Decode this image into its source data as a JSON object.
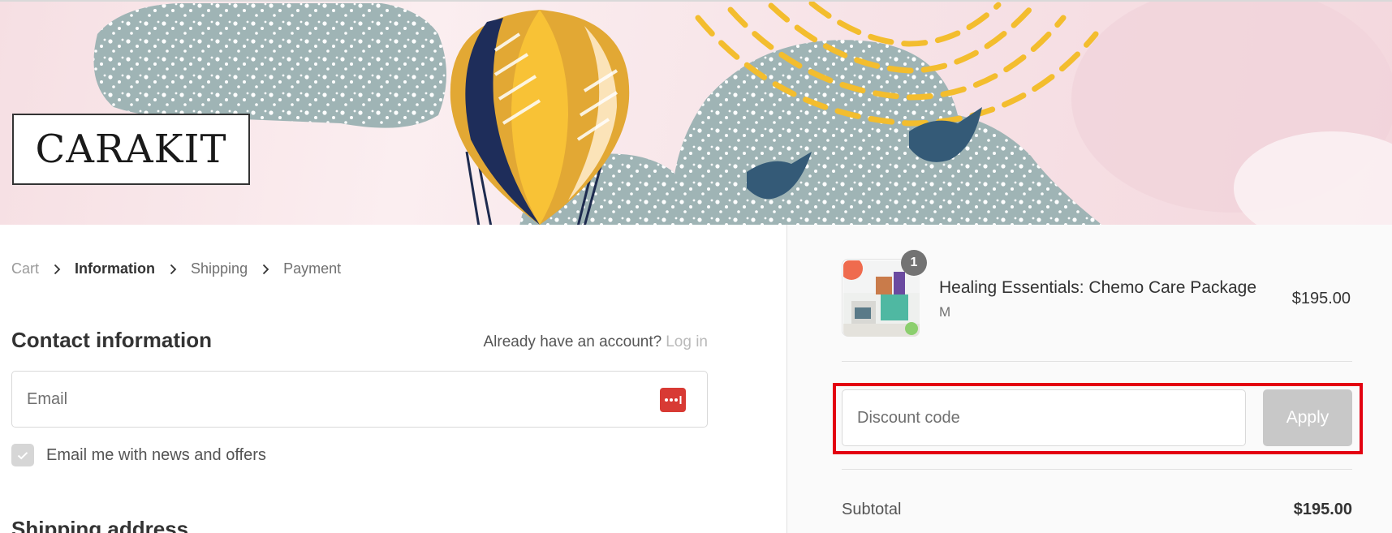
{
  "header": {
    "logo_text": "CARAKIT"
  },
  "breadcrumb": {
    "items": [
      {
        "label": "Cart",
        "state": "link"
      },
      {
        "label": "Information",
        "state": "current"
      },
      {
        "label": "Shipping",
        "state": "upcoming"
      },
      {
        "label": "Payment",
        "state": "upcoming"
      }
    ]
  },
  "contact": {
    "title": "Contact information",
    "account_prompt": "Already have an account?",
    "login_label": "Log in",
    "email_placeholder": "Email",
    "email_value": "",
    "newsletter_label": "Email me with news and offers",
    "newsletter_checked": true
  },
  "shipping": {
    "title": "Shipping address"
  },
  "order_summary": {
    "items": [
      {
        "name": "Healing Essentials: Chemo Care Package",
        "variant": "M",
        "quantity": "1",
        "price": "$195.00"
      }
    ],
    "discount_placeholder": "Discount code",
    "apply_label": "Apply",
    "subtotal_label": "Subtotal",
    "subtotal_value": "$195.00"
  },
  "colors": {
    "highlight": "#e30011",
    "password_manager_icon": "#d83a34",
    "apply_button_disabled": "#c8c8c8"
  },
  "icons": [
    "chevron-right-icon",
    "password-manager-icon",
    "checkmark-icon"
  ]
}
